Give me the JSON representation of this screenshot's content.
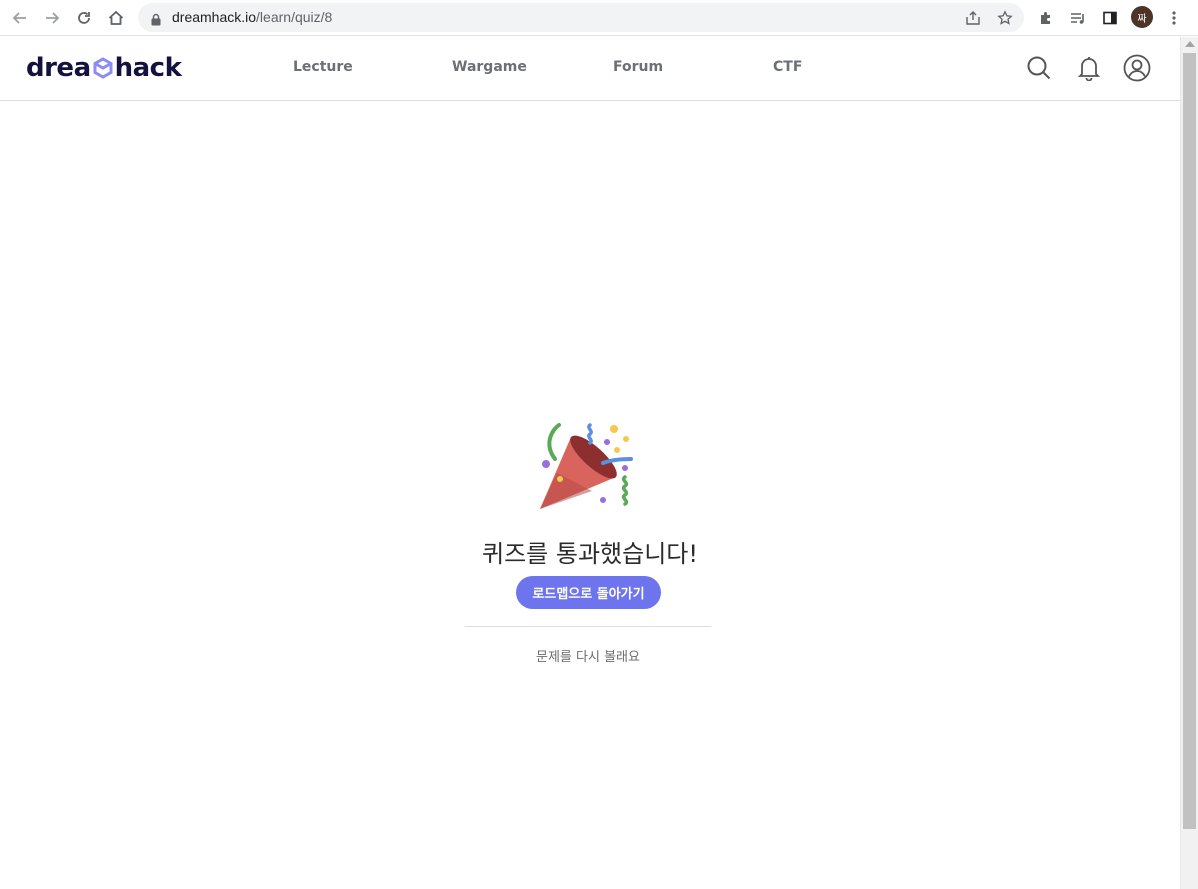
{
  "browser": {
    "url_host": "dreamhack.io",
    "url_path": "/learn/quiz/8",
    "profile_initial": "짜",
    "icons": [
      "back-icon",
      "forward-icon",
      "reload-icon",
      "home-icon",
      "lock-icon",
      "share-icon",
      "bookmark-star-icon",
      "extensions-icon",
      "media-queue-icon",
      "side-panel-icon",
      "profile-avatar",
      "more-menu-icon"
    ]
  },
  "header": {
    "logo_left": "drea",
    "logo_right": "hack",
    "nav": [
      {
        "label": "Lecture"
      },
      {
        "label": "Wargame"
      },
      {
        "label": "Forum"
      },
      {
        "label": "CTF"
      }
    ],
    "icons": [
      "search-icon",
      "bell-icon",
      "user-icon"
    ]
  },
  "result": {
    "title": "퀴즈를 통과했습니다!",
    "roadmap_button": "로드맵으로 돌아가기",
    "retry_link": "문제를 다시 볼래요",
    "icon": "party-popper-icon"
  },
  "colors": {
    "accent": "#6d74ee",
    "logo": "#13123f",
    "logo_mark": "#8c8cf6",
    "nav_text": "#6b6f76"
  }
}
